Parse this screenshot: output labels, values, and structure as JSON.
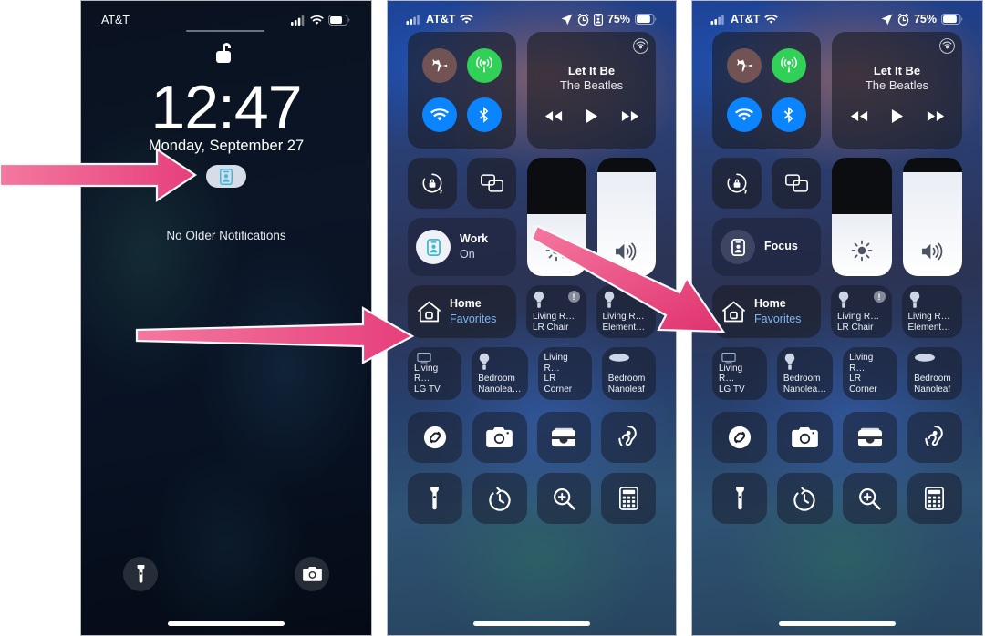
{
  "lock_screen": {
    "status_bar": {
      "carrier": "AT&T",
      "signal_icon": "cellular-bars-icon",
      "wifi_icon": "wifi-icon",
      "battery_icon": "battery-icon"
    },
    "unlock_icon": "unlocked-padlock-icon",
    "time": "12:47",
    "date": "Monday, September 27",
    "focus_pill_icon": "work-focus-badge-icon",
    "notifications_text": "No Older Notifications",
    "flashlight_icon": "flashlight-icon",
    "camera_icon": "camera-icon"
  },
  "control_center": {
    "status_bar": {
      "signal_icon": "cellular-bars-icon",
      "carrier": "AT&T",
      "wifi_icon": "wifi-icon",
      "location_icon": "location-arrow-icon",
      "alarm_icon": "alarm-clock-icon",
      "focus_icon": "work-focus-badge-icon",
      "battery_percent": "75%",
      "battery_icon": "battery-icon"
    },
    "connectivity": {
      "airplane_label": "airplane-mode-icon",
      "cellular_label": "cellular-data-icon",
      "wifi_label": "wifi-icon",
      "bluetooth_label": "bluetooth-icon",
      "airplane_color": "#8c5f55",
      "cellular_color": "#31d158",
      "wifi_color": "#0a84ff",
      "bluetooth_color": "#0a84ff"
    },
    "media": {
      "airplay_icon": "airplay-audio-icon",
      "title": "Let It Be",
      "artist": "The Beatles",
      "rewind_icon": "rewind-icon",
      "play_icon": "play-icon",
      "forward_icon": "fast-forward-icon"
    },
    "rotation_lock_icon": "rotation-lock-icon",
    "screen_mirroring_icon": "screen-mirroring-icon",
    "brightness_icon": "brightness-icon",
    "volume_icon": "volume-icon",
    "brightness_level": 52,
    "volume_level": 88,
    "home": {
      "title": "Home",
      "subtitle": "Favorites",
      "house_icon": "house-icon"
    },
    "accessories_row1": [
      {
        "room": "Living R…",
        "name": "LR Chair",
        "icon": "lightbulb-icon",
        "alert": "!"
      },
      {
        "room": "Living R…",
        "name": "Element…",
        "icon": "lightbulb-icon",
        "alert": ""
      }
    ],
    "accessories_row2": [
      {
        "room": "Living R…",
        "name": "LG TV",
        "icon": "tv-icon",
        "alert": ""
      },
      {
        "room": "Bedroom",
        "name": "Nanolea…",
        "icon": "lightbulb-icon",
        "alert": ""
      },
      {
        "room": "Living R…",
        "name": "LR Corner",
        "icon": "lightbulb-icon",
        "alert": ""
      },
      {
        "room": "Bedroom",
        "name": "Nanoleaf",
        "icon": "nanoleaf-bar-icon",
        "alert": ""
      }
    ],
    "utilities_row1": [
      "shazam-icon",
      "camera-icon",
      "wallet-icon",
      "hearing-icon"
    ],
    "utilities_row2": [
      "flashlight-icon",
      "timer-icon",
      "magnifier-icon",
      "calculator-icon"
    ]
  },
  "focus_tile_on": {
    "label": "Work",
    "status": "On",
    "icon": "work-focus-badge-icon",
    "state": "on"
  },
  "focus_tile_off": {
    "label": "Focus",
    "status": "",
    "icon": "focus-badge-icon",
    "state": "off"
  },
  "annotations": {
    "arrow_color": "#ea4a84",
    "arrow_outline": "#f7f7f9",
    "arrows": [
      {
        "name": "arrow-to-lockscreen-focus-pill"
      },
      {
        "name": "arrow-to-work-focus-tile"
      },
      {
        "name": "arrow-to-focus-off-tile"
      }
    ]
  }
}
